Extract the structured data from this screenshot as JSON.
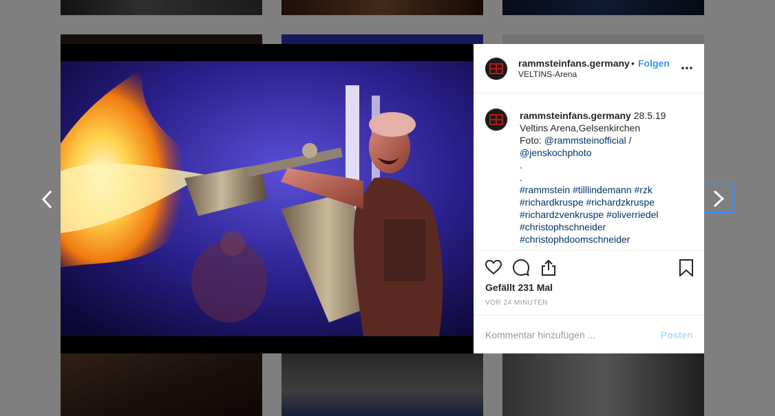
{
  "post": {
    "username": "rammsteinfans.germany",
    "follow_label": "Folgen",
    "separator": "•",
    "location": "VELTINS-Arena",
    "caption_lines": [
      "28.5.19",
      "Veltins Arena,Gelsenkirchen",
      "Foto: ",
      "@rammsteinofficial",
      " /",
      "@jenskochphoto",
      ".",
      ".",
      "#rammstein #tilllindemann #rzk",
      "#richardkruspe #richardzkruspe",
      "#richardzvenkruspe #oliverriedel",
      "#christophschneider",
      "#christophdoomschneider"
    ],
    "likes_text": "Gefällt 231 Mal",
    "time_ago": "VOR 24 MINUTEN",
    "comment_placeholder": "Kommentar hinzufügen ...",
    "post_label": "Posten"
  },
  "icons": {
    "prev": "chevron-left-icon",
    "next": "chevron-right-icon",
    "like": "heart-icon",
    "comment": "comment-icon",
    "share": "share-icon",
    "save": "bookmark-icon",
    "more": "more-dots-icon"
  },
  "colors": {
    "link": "#003569",
    "follow": "#3897f0",
    "post_disabled": "#b3dbff"
  }
}
